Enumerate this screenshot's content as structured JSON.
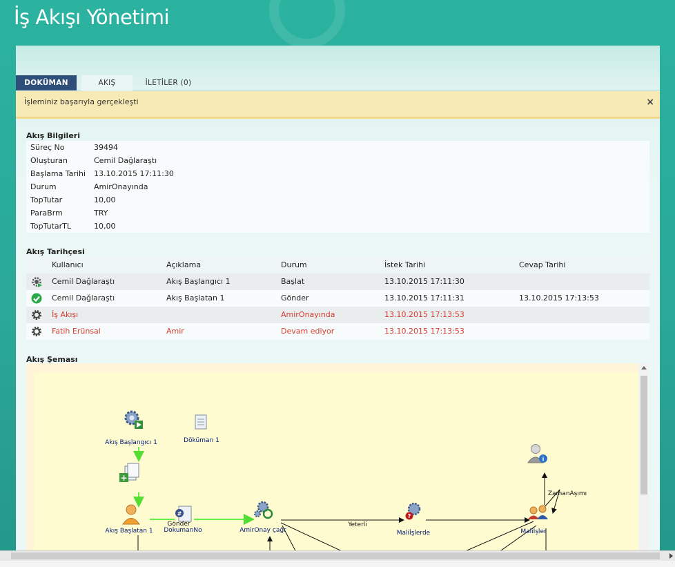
{
  "app": {
    "title": "İş Akışı Yönetimi"
  },
  "tabs": [
    {
      "label": "DOKÜMAN",
      "active": true
    },
    {
      "label": "AKIŞ",
      "active": false
    },
    {
      "label": "İLETİLER (0)",
      "active": false
    }
  ],
  "alert": {
    "message": "İşleminiz başarıyla gerçekleşti",
    "close": "×"
  },
  "info": {
    "title": "Akış Bilgileri",
    "rows": [
      {
        "key": "Süreç No",
        "value": "39494"
      },
      {
        "key": "Oluşturan",
        "value": "Cemil Dağlaraştı"
      },
      {
        "key": "Başlama Tarihi",
        "value": "13.10.2015 17:11:30"
      },
      {
        "key": "Durum",
        "value": "AmirOnayında"
      },
      {
        "key": "TopTutar",
        "value": "10,00"
      },
      {
        "key": "ParaBrm",
        "value": "TRY"
      },
      {
        "key": "TopTutarTL",
        "value": "10,00"
      }
    ]
  },
  "history": {
    "title": "Akış Tarihçesi",
    "columns": [
      "Kullanıcı",
      "Açıklama",
      "Durum",
      "İstek Tarihi",
      "Cevap Tarihi"
    ],
    "rows": [
      {
        "icon": "gear-play-icon",
        "user": "Cemil Dağlaraştı",
        "desc": "Akış Başlangıcı 1",
        "status": "Başlat",
        "request": "13.10.2015 17:11:30",
        "response": "",
        "highlight": false
      },
      {
        "icon": "check-circle-icon",
        "user": "Cemil Dağlaraştı",
        "desc": "Akış Başlatan 1",
        "status": "Gönder",
        "request": "13.10.2015 17:11:31",
        "response": "13.10.2015 17:13:53",
        "highlight": false
      },
      {
        "icon": "gear-icon",
        "user": "İş Akışı",
        "desc": "",
        "status": "AmirOnayında",
        "request": "13.10.2015 17:13:53",
        "response": "",
        "highlight": true
      },
      {
        "icon": "gear-icon",
        "user": "Fatih Erünsal",
        "desc": "Amir",
        "status": "Devam ediyor",
        "request": "13.10.2015 17:13:53",
        "response": "",
        "highlight": true
      }
    ]
  },
  "diagram": {
    "title": "Akış Şeması",
    "nodes": {
      "start": "Akış Başlangıcı 1",
      "doc": "Döküman 1",
      "initiator": "Akış Başlatan 1",
      "send_1": "Gönder",
      "send_2": "DokumanNo",
      "approval": "AmirOnay çağr",
      "finance": "Maliİşlerde",
      "finance_group": "Maliİşler"
    },
    "edges": {
      "enough": "Yeterli",
      "timeout": "ZamanAşımı"
    }
  },
  "colors": {
    "background": "#2bb3a0",
    "tab_active": "#2e4f7a",
    "alert": "#f8eab5",
    "highlight_text": "#d63b2f",
    "flow_arrow": "#66ee44"
  }
}
